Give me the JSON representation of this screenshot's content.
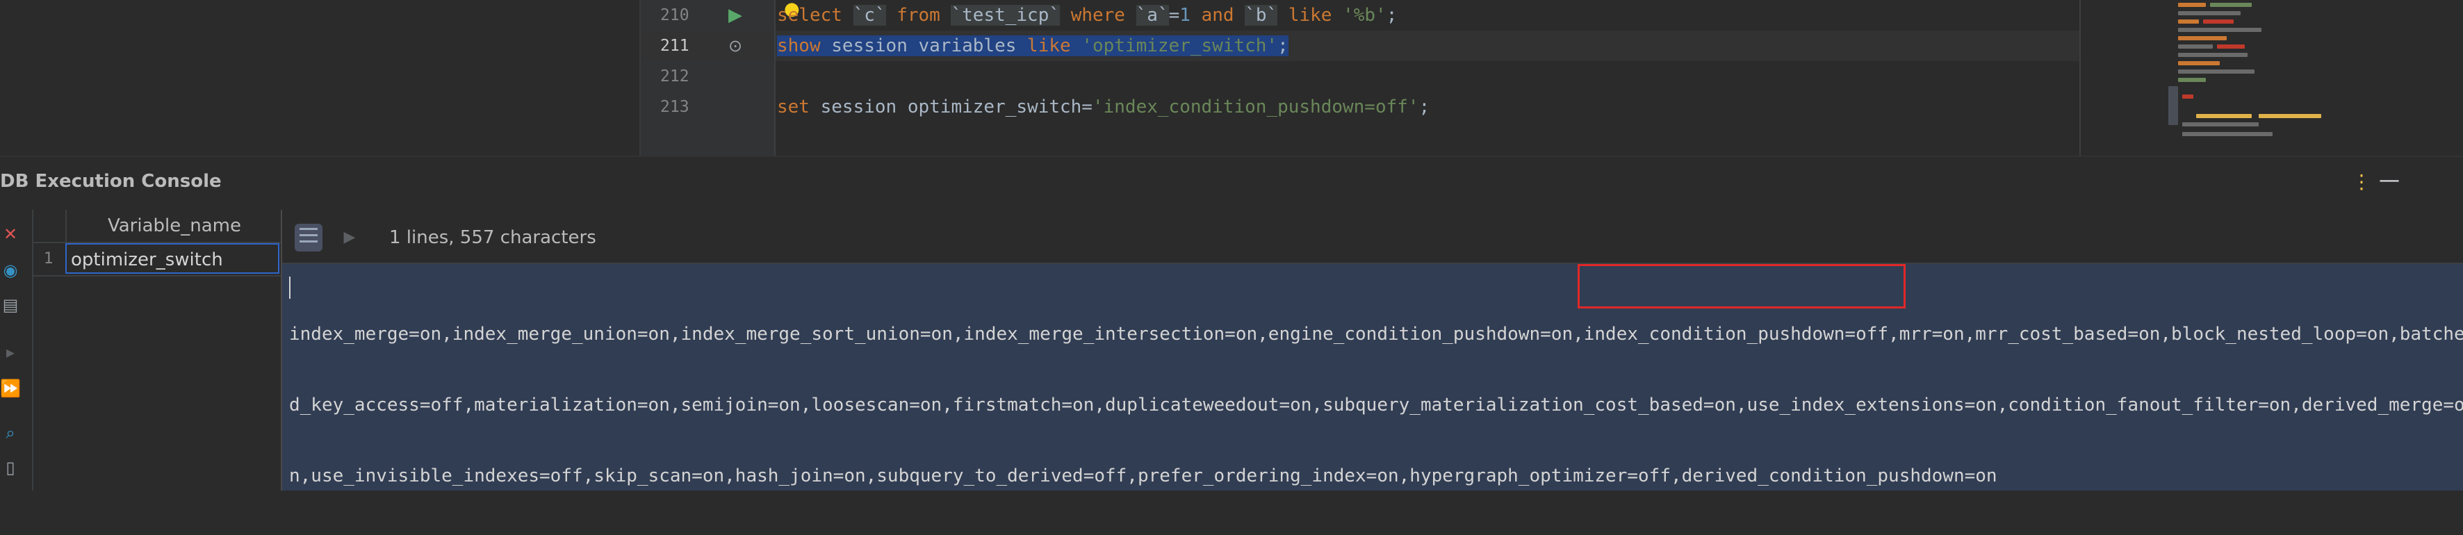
{
  "editor": {
    "lines": [
      {
        "number": "210",
        "icon": "run-icon",
        "code": [
          {
            "t": "select",
            "c": "kw"
          },
          {
            "t": " ",
            "c": ""
          },
          {
            "t": "`c`",
            "c": "bt"
          },
          {
            "t": " ",
            "c": ""
          },
          {
            "t": "from",
            "c": "kw"
          },
          {
            "t": " ",
            "c": ""
          },
          {
            "t": "`test_icp`",
            "c": "bt"
          },
          {
            "t": " ",
            "c": ""
          },
          {
            "t": "where",
            "c": "kw"
          },
          {
            "t": " ",
            "c": ""
          },
          {
            "t": "`a`",
            "c": "bt"
          },
          {
            "t": "=",
            "c": ""
          },
          {
            "t": "1",
            "c": "num"
          },
          {
            "t": " ",
            "c": ""
          },
          {
            "t": "and",
            "c": "kw"
          },
          {
            "t": " ",
            "c": ""
          },
          {
            "t": "`b`",
            "c": "bt"
          },
          {
            "t": " ",
            "c": ""
          },
          {
            "t": "like",
            "c": "kw"
          },
          {
            "t": " ",
            "c": ""
          },
          {
            "t": "'%b'",
            "c": "str"
          },
          {
            "t": ";",
            "c": ""
          }
        ]
      },
      {
        "number": "211",
        "icon": "settings-icon",
        "code": [
          {
            "t": "show",
            "c": "kw sel"
          },
          {
            "t": " session variables ",
            "c": "sel"
          },
          {
            "t": "like",
            "c": "kw sel"
          },
          {
            "t": " ",
            "c": "sel"
          },
          {
            "t": "'optimizer_switch'",
            "c": "str sel"
          },
          {
            "t": ";",
            "c": "sel"
          }
        ]
      },
      {
        "number": "212",
        "icon": "",
        "code": []
      },
      {
        "number": "213",
        "icon": "",
        "code": [
          {
            "t": "set",
            "c": "kw"
          },
          {
            "t": " session optimizer_switch=",
            "c": ""
          },
          {
            "t": "'index_condition_pushdown=off'",
            "c": "str"
          },
          {
            "t": ";",
            "c": ""
          }
        ]
      }
    ]
  },
  "console": {
    "title": "DB Execution Console",
    "menu_icon": "⋮",
    "minimize_icon": "—"
  },
  "toolbar": {
    "icons": [
      "close-icon",
      "view-icon",
      "layout-icon",
      "step-icon",
      "run-all-icon",
      "search-icon",
      "document-icon"
    ]
  },
  "grid": {
    "column": "Variable_name",
    "rows": [
      {
        "num": "1",
        "value": "optimizer_switch"
      }
    ]
  },
  "viewer": {
    "status": "1 lines, 557 characters",
    "text_lines": [
      "index_merge=on,index_merge_union=on,index_merge_sort_union=on,index_merge_intersection=on,engine_condition_pushdown=on,index_condition_pushdown=off,mrr=on,mrr_cost_based=on,block_nested_loop=on,batche",
      "d_key_access=off,materialization=on,semijoin=on,loosescan=on,firstmatch=on,duplicateweedout=on,subquery_materialization_cost_based=on,use_index_extensions=on,condition_fanout_filter=on,derived_merge=o",
      "n,use_invisible_indexes=off,skip_scan=on,hash_join=on,subquery_to_derived=off,prefer_ordering_index=on,hypergraph_optimizer=off,derived_condition_pushdown=on"
    ]
  },
  "colors": {
    "keyword": "#cc7832",
    "string": "#6a8759",
    "selection": "#214283",
    "viewer_bg": "#313d53",
    "highlight": "#e02828"
  }
}
